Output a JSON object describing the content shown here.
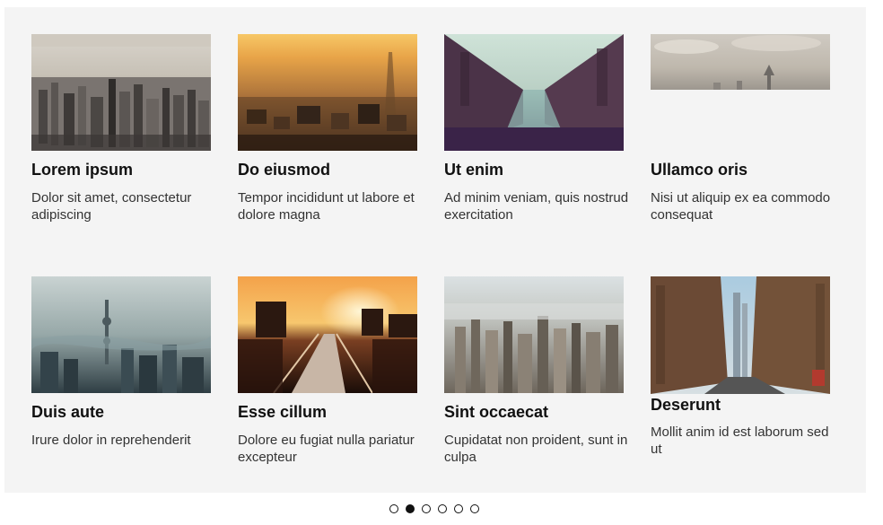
{
  "carousel": {
    "cards": [
      {
        "title": "Lorem ipsum",
        "description": "Dolor sit amet, consectetur adipiscing",
        "image": "aerial-city-skyline-photo"
      },
      {
        "title": "Do eiusmod",
        "description": "Tempor incididunt ut labore et dolore magna",
        "image": "golden-hour-city-photo"
      },
      {
        "title": "Ut enim",
        "description": "Ad minim veniam, quis nostrud exercitation",
        "image": "canal-dusk-photo"
      },
      {
        "title": "Ullamco oris",
        "description": "Nisi ut aliquip ex ea commodo consequat",
        "image": "cloudy-skyline-photo"
      },
      {
        "title": "Duis aute",
        "description": "Irure dolor in reprehenderit",
        "image": "hazy-city-tower-photo"
      },
      {
        "title": "Esse cillum",
        "description": "Dolore eu fugiat nulla pariatur excepteur",
        "image": "sunset-rail-photo"
      },
      {
        "title": "Sint occaecat",
        "description": "Cupidatat non proident, sunt in culpa",
        "image": "foggy-downtown-photo"
      },
      {
        "title": "Deserunt",
        "description": "Mollit anim id est laborum sed ut",
        "image": "street-canyon-photo"
      }
    ],
    "pagination": {
      "total": 6,
      "active": 2
    }
  }
}
